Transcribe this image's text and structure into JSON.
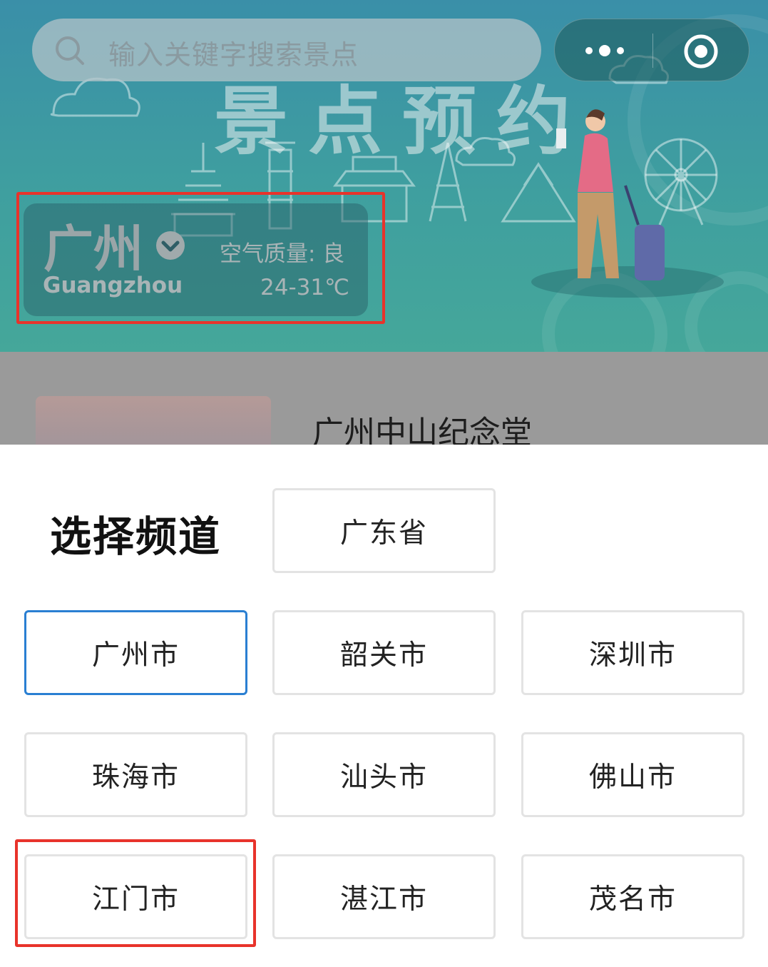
{
  "search": {
    "placeholder": "输入关键字搜索景点",
    "icon": "search-icon"
  },
  "capsule": {
    "more_icon": "more-dots-icon",
    "close_icon": "target-close-icon"
  },
  "banner": {
    "title": "景点预约"
  },
  "city": {
    "name": "广州",
    "name_en": "Guangzhou",
    "air_quality": "空气质量: 良",
    "temperature": "24-31℃"
  },
  "list": {
    "first_item_title": "广州中山纪念堂"
  },
  "channel_sheet": {
    "title": "选择频道",
    "province": "广东省",
    "cities": [
      "广州市",
      "韶关市",
      "深圳市",
      "珠海市",
      "汕头市",
      "佛山市",
      "江门市",
      "湛江市",
      "茂名市"
    ],
    "selected": "广州市"
  },
  "colors": {
    "selected_border": "#2a7fd2",
    "highlight_box": "#e8332b",
    "banner_teal": "#3f9f9f"
  }
}
